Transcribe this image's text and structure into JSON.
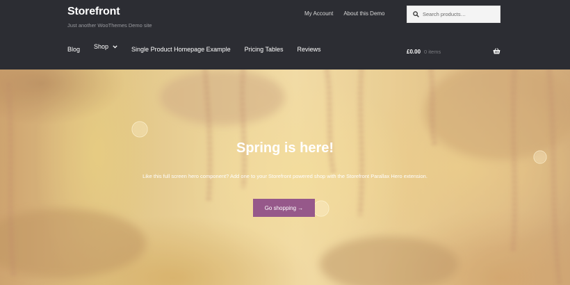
{
  "site": {
    "title": "Storefront",
    "tagline": "Just another WooThemes Demo site"
  },
  "top_links": [
    "My Account",
    "About this Demo"
  ],
  "search": {
    "placeholder": "Search products…",
    "icon": "search-icon"
  },
  "nav": {
    "items": [
      {
        "label": "Blog"
      },
      {
        "label": "Shop",
        "has_dropdown": true
      },
      {
        "label": "Single Product Homepage Example"
      },
      {
        "label": "Pricing Tables"
      },
      {
        "label": "Reviews"
      }
    ]
  },
  "cart": {
    "amount": "£0.00",
    "count": "0 items",
    "icon": "basket-icon"
  },
  "hero": {
    "heading": "Spring is here!",
    "text": "Like this full screen hero component? Add one to your Storefront powered shop with the Storefront Parallax Hero extension.",
    "button_label": "Go shopping →"
  },
  "colors": {
    "header_bg": "#2c2d33",
    "accent": "#96588a",
    "hero_tone": "#e9d092"
  }
}
